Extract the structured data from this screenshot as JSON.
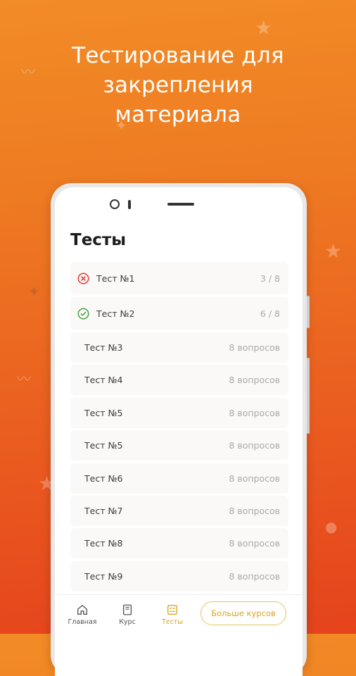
{
  "promo": {
    "headline_lines": [
      "Тестирование для",
      "закрепления",
      "материала"
    ]
  },
  "screen": {
    "title": "Тесты",
    "tests": [
      {
        "name": "Тест №1",
        "value": "3 / 8",
        "status": "failed",
        "icon": "cross-circle-icon"
      },
      {
        "name": "Тест №2",
        "value": "6 / 8",
        "status": "passed",
        "icon": "check-circle-icon"
      },
      {
        "name": "Тест №3",
        "value": "8 вопросов"
      },
      {
        "name": "Тест №4",
        "value": "8 вопросов"
      },
      {
        "name": "Тест №5",
        "value": "8 вопросов"
      },
      {
        "name": "Тест №5",
        "value": "8 вопросов"
      },
      {
        "name": "Тест №6",
        "value": "8 вопросов"
      },
      {
        "name": "Тест №7",
        "value": "8 вопросов"
      },
      {
        "name": "Тест №8",
        "value": "8 вопросов"
      },
      {
        "name": "Тест №9",
        "value": "8 вопросов"
      }
    ]
  },
  "tabbar": {
    "home": {
      "label": "Главная",
      "icon": "home-icon"
    },
    "course": {
      "label": "Курс",
      "icon": "book-icon"
    },
    "tests": {
      "label": "Тесты",
      "icon": "tests-icon",
      "active": true
    },
    "more_courses": "Больше курсов"
  },
  "colors": {
    "accent": "#d9a521",
    "failed": "#e53935",
    "passed": "#43a047",
    "background_top": "#f28c26",
    "background_bottom": "#e5431c"
  }
}
